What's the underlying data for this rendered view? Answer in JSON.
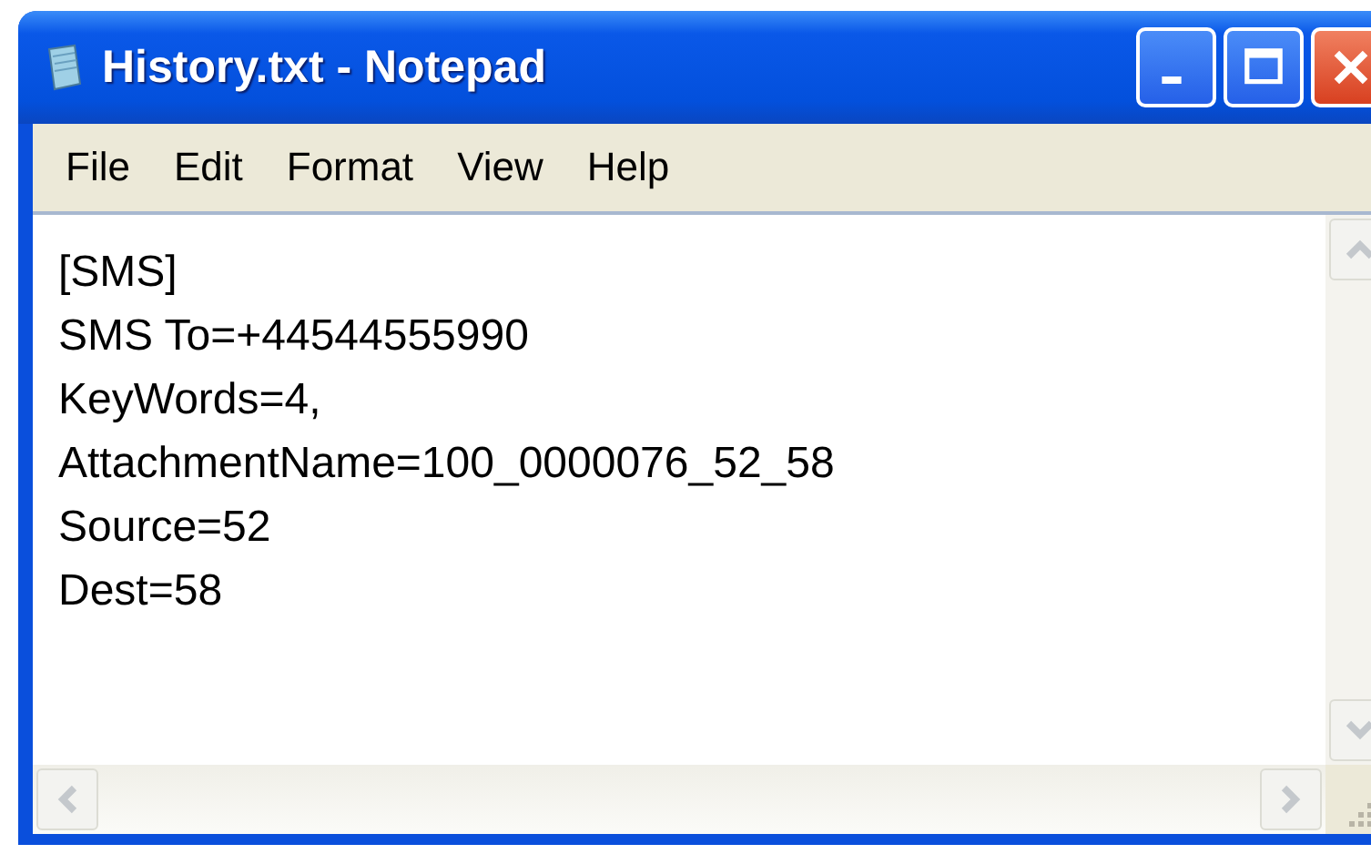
{
  "window": {
    "title": "History.txt - Notepad"
  },
  "menu": [
    {
      "label": "File"
    },
    {
      "label": "Edit"
    },
    {
      "label": "Format"
    },
    {
      "label": "View"
    },
    {
      "label": "Help"
    }
  ],
  "document": {
    "lines": [
      "[SMS]",
      "SMS To=+44544555990",
      "KeyWords=4,",
      "AttachmentName=100_0000076_52_58",
      "Source=52",
      "Dest=58"
    ]
  }
}
